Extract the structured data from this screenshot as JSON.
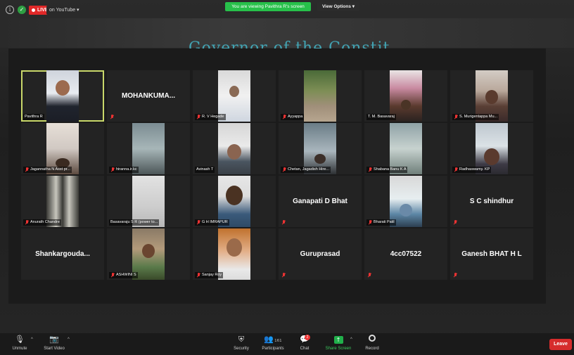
{
  "window": {
    "live_label": "LIVE",
    "stream_label": "on YouTube ▾",
    "viewing_banner": "You are viewing Pavithra R's screen",
    "view_options_label": "View Options ▾",
    "shared_screen_title": "Governor of the Constit..."
  },
  "gallery": {
    "tiles": [
      {
        "name": "Pavithra R",
        "muted": false,
        "video": true,
        "active": true
      },
      {
        "name": "MOHANKUMA...",
        "muted": true,
        "video": false
      },
      {
        "name": "R. V Hegade",
        "muted": true,
        "video": true
      },
      {
        "name": "Ayyappa",
        "muted": true,
        "video": true
      },
      {
        "name": "T. M. Basavaraj",
        "muted": false,
        "video": true
      },
      {
        "name": "S. Murigentappa Mu...",
        "muted": true,
        "video": true
      },
      {
        "name": "Jagannatha N Asst pr...",
        "muted": true,
        "video": true
      },
      {
        "name": "hiranna.ir.kc",
        "muted": true,
        "video": true
      },
      {
        "name": "Avinash T",
        "muted": false,
        "video": true
      },
      {
        "name": "Chetan, Jagadish Hire...",
        "muted": true,
        "video": true
      },
      {
        "name": "Shabana Banu K A",
        "muted": true,
        "video": true
      },
      {
        "name": "Radhaswamy. KP",
        "muted": true,
        "video": true
      },
      {
        "name": "Anurath Chandre",
        "muted": true,
        "video": true
      },
      {
        "name": "Basavaraju S R (power to...",
        "muted": false,
        "video": true
      },
      {
        "name": "G H IMRAPUR",
        "muted": true,
        "video": true
      },
      {
        "name": "Ganapati D Bhat",
        "muted": true,
        "video": false
      },
      {
        "name": "Bharati Patil",
        "muted": true,
        "video": true
      },
      {
        "name": "S C shindhur",
        "muted": true,
        "video": false
      },
      {
        "name": "Shankargouda...",
        "muted": false,
        "video": false
      },
      {
        "name": "ASHWINI S",
        "muted": true,
        "video": true
      },
      {
        "name": "Sanjay Roy",
        "muted": true,
        "video": true
      },
      {
        "name": "Guruprasad",
        "muted": true,
        "video": false
      },
      {
        "name": "4cc07522",
        "muted": true,
        "video": false
      },
      {
        "name": "Ganesh BHAT H L",
        "muted": true,
        "video": false
      }
    ]
  },
  "toolbar": {
    "unmute": "Unmute",
    "start_video": "Start Video",
    "security": "Security",
    "participants": "Participants",
    "participant_count": "161",
    "chat": "Chat",
    "chat_badge": "2",
    "share_screen": "Share Screen",
    "record": "Record",
    "leave": "Leave"
  },
  "colors": {
    "active_tile_border": "#c9d86a",
    "live_red": "#e02828",
    "banner_green": "#27c04a",
    "share_green": "#21b04b",
    "leave_red": "#d62c2c"
  }
}
